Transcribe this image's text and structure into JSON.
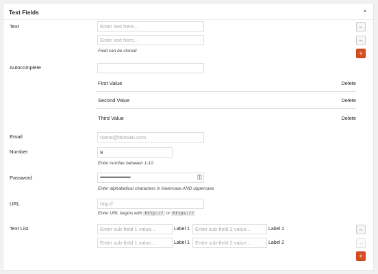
{
  "section": {
    "title": "Text Fields",
    "collapse_glyph": "▲"
  },
  "text": {
    "label": "Text",
    "placeholder": "Enter text here...",
    "note": "Field can be cloned",
    "remove_glyph": "–",
    "add_glyph": "+"
  },
  "autocomplete": {
    "label": "Autocomplete",
    "values": [
      "First Value",
      "Second Value",
      "Third Value"
    ],
    "delete_label": "Delete"
  },
  "email": {
    "label": "Email",
    "placeholder": "name@domain.com"
  },
  "number": {
    "label": "Number",
    "value": "9",
    "note": "Enter number between 1-10"
  },
  "password": {
    "label": "Password",
    "value": "••••••••••••••••••••••••••••••••••••••••",
    "note": "Enter alphabetical characters in lowercase AND uppercase",
    "icon_glyph": "⚿"
  },
  "url": {
    "label": "URL",
    "placeholder": "http://",
    "note_prefix": "Enter URL begins with",
    "code1": "http://",
    "note_or": "or",
    "code2": "https://"
  },
  "textlist": {
    "label": "Text List",
    "sub1_placeholder": "Enter sub-field 1 value...",
    "sub2_placeholder": "Enter sub-field 2 value...",
    "label1": "Label 1",
    "label2": "Label 2",
    "remove_glyph": "–",
    "add_glyph": "+"
  }
}
